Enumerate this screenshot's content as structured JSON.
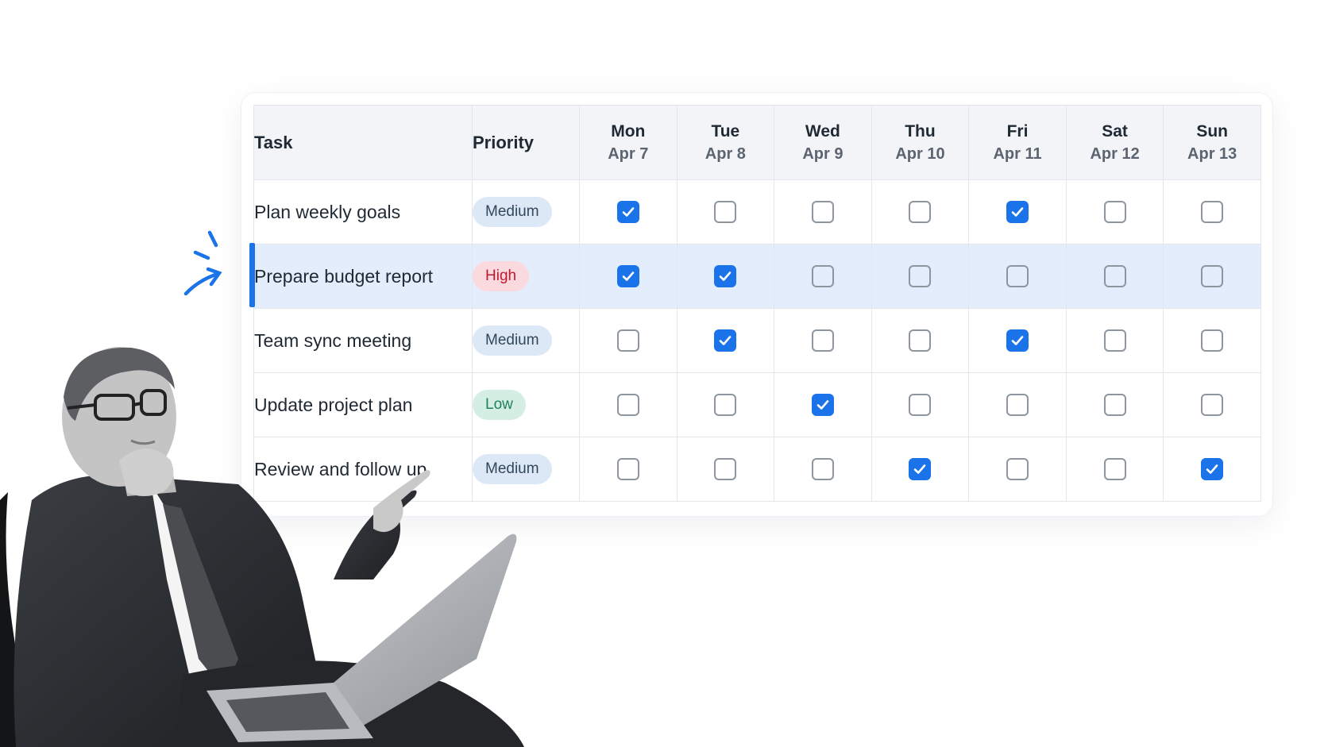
{
  "table": {
    "headers": {
      "task": "Task",
      "priority": "Priority"
    },
    "days": [
      {
        "name": "Mon",
        "date": "Apr 7"
      },
      {
        "name": "Tue",
        "date": "Apr 8"
      },
      {
        "name": "Wed",
        "date": "Apr 9"
      },
      {
        "name": "Thu",
        "date": "Apr 10"
      },
      {
        "name": "Fri",
        "date": "Apr 11"
      },
      {
        "name": "Sat",
        "date": "Apr 12"
      },
      {
        "name": "Sun",
        "date": "Apr 13"
      }
    ],
    "rows": [
      {
        "task": "Plan weekly goals",
        "priority": "Medium",
        "priority_level": "medium",
        "highlighted": false,
        "checks": [
          true,
          false,
          false,
          false,
          true,
          false,
          false
        ]
      },
      {
        "task": "Prepare budget report",
        "priority": "High",
        "priority_level": "high",
        "highlighted": true,
        "checks": [
          true,
          true,
          false,
          false,
          false,
          false,
          false
        ]
      },
      {
        "task": "Team sync meeting",
        "priority": "Medium",
        "priority_level": "medium",
        "highlighted": false,
        "checks": [
          false,
          true,
          false,
          false,
          true,
          false,
          false
        ]
      },
      {
        "task": "Update project plan",
        "priority": "Low",
        "priority_level": "low",
        "highlighted": false,
        "checks": [
          false,
          false,
          true,
          false,
          false,
          false,
          false
        ]
      },
      {
        "task": "Review and follow up",
        "priority": "Medium",
        "priority_level": "medium",
        "highlighted": false,
        "checks": [
          false,
          false,
          false,
          true,
          false,
          false,
          true
        ]
      }
    ]
  },
  "colors": {
    "accent": "#1a73e8",
    "header_bg": "#f2f4f7",
    "highlight_row": "#e3edfb",
    "badge_medium": "#dde8f7",
    "badge_high": "#fbdadf",
    "badge_low": "#d4eee4"
  },
  "icons": {
    "checkmark": "check-icon",
    "pointer": "hand-drawn-arrow-icon"
  }
}
